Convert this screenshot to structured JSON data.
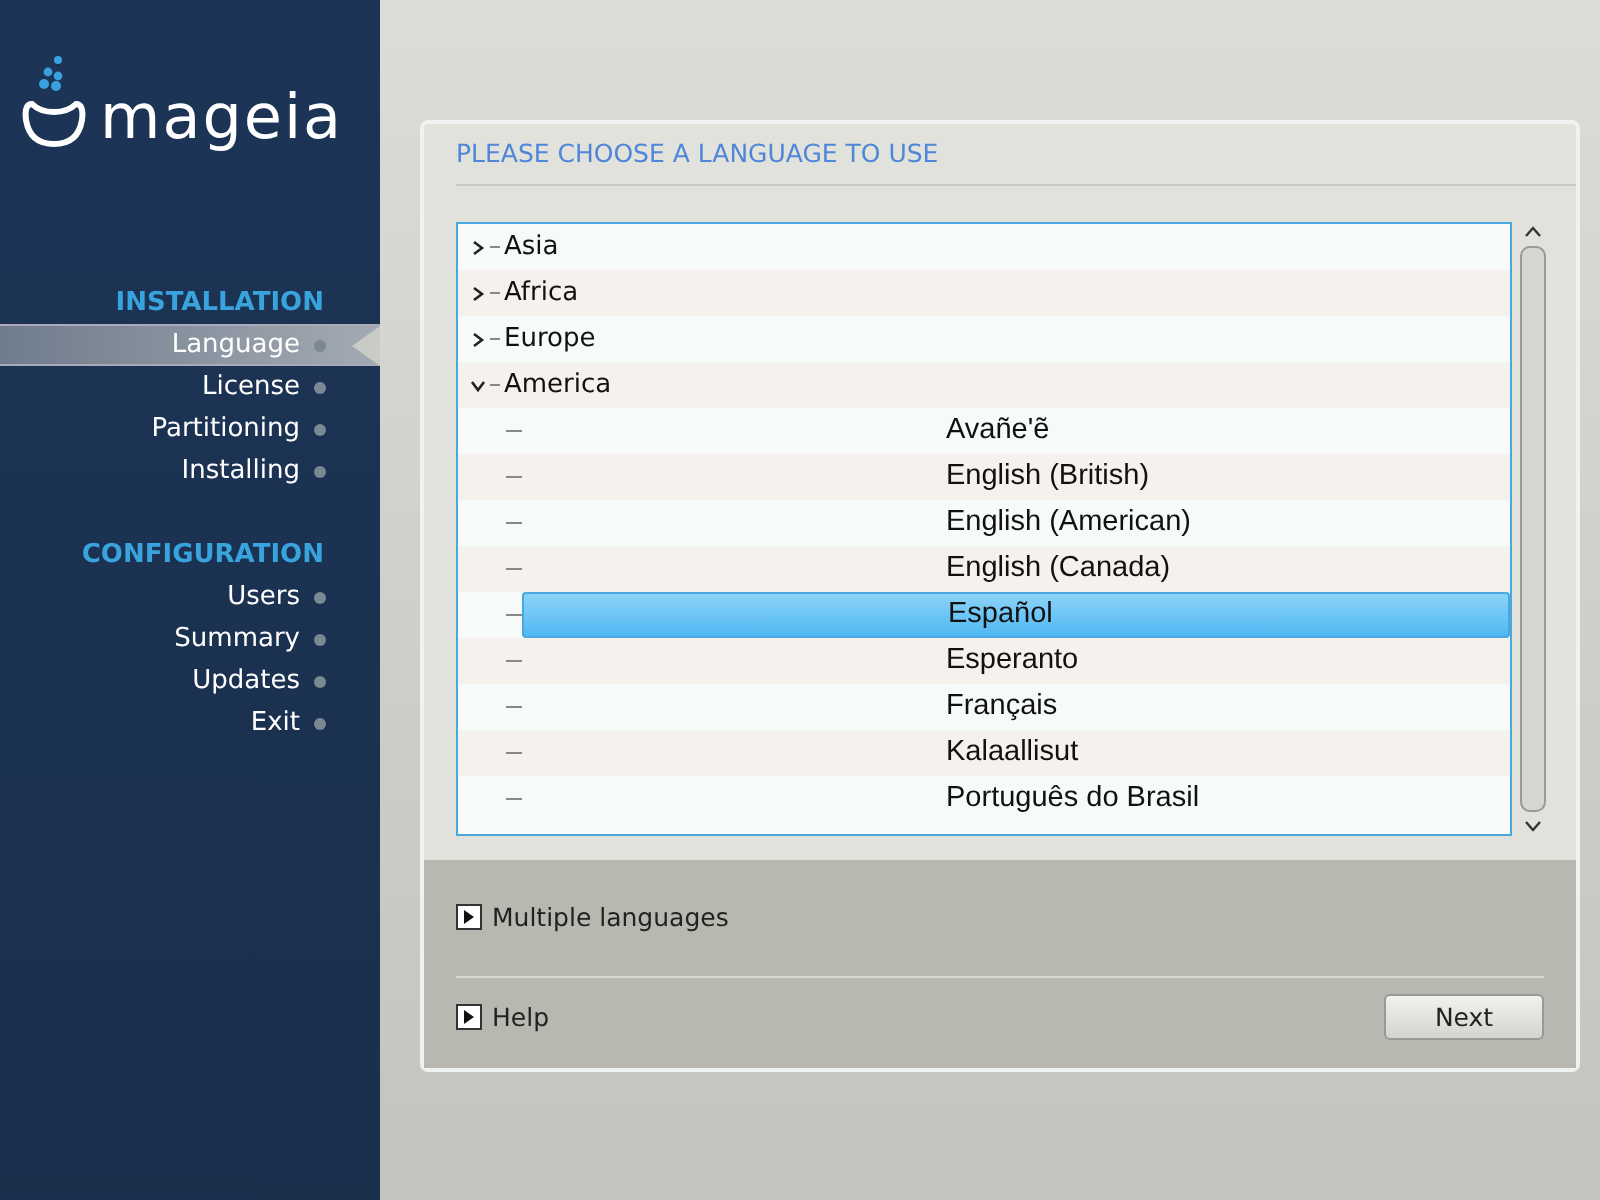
{
  "sidebar": {
    "logo_text": "mageia",
    "sections": [
      {
        "title": "INSTALLATION",
        "items": [
          {
            "label": "Language",
            "selected": true
          },
          {
            "label": "License",
            "selected": false
          },
          {
            "label": "Partitioning",
            "selected": false
          },
          {
            "label": "Installing",
            "selected": false
          }
        ]
      },
      {
        "title": "CONFIGURATION",
        "items": [
          {
            "label": "Users",
            "selected": false
          },
          {
            "label": "Summary",
            "selected": false
          },
          {
            "label": "Updates",
            "selected": false
          },
          {
            "label": "Exit",
            "selected": false
          }
        ]
      }
    ]
  },
  "panel": {
    "title": "PLEASE CHOOSE A LANGUAGE TO USE",
    "tree": [
      {
        "label": "Asia",
        "expanded": false
      },
      {
        "label": "Africa",
        "expanded": false
      },
      {
        "label": "Europe",
        "expanded": false
      },
      {
        "label": "America",
        "expanded": true,
        "children": [
          {
            "label": "Avañe'ẽ",
            "selected": false
          },
          {
            "label": "English (British)",
            "selected": false
          },
          {
            "label": "English (American)",
            "selected": false
          },
          {
            "label": "English (Canada)",
            "selected": false
          },
          {
            "label": "Español",
            "selected": true
          },
          {
            "label": "Esperanto",
            "selected": false
          },
          {
            "label": "Français",
            "selected": false
          },
          {
            "label": "Kalaallisut",
            "selected": false
          },
          {
            "label": "Português do Brasil",
            "selected": false
          }
        ]
      }
    ],
    "multiple_languages": {
      "label": "Multiple languages",
      "expanded": false
    },
    "help": {
      "label": "Help",
      "expanded": false
    },
    "next_button": "Next"
  }
}
